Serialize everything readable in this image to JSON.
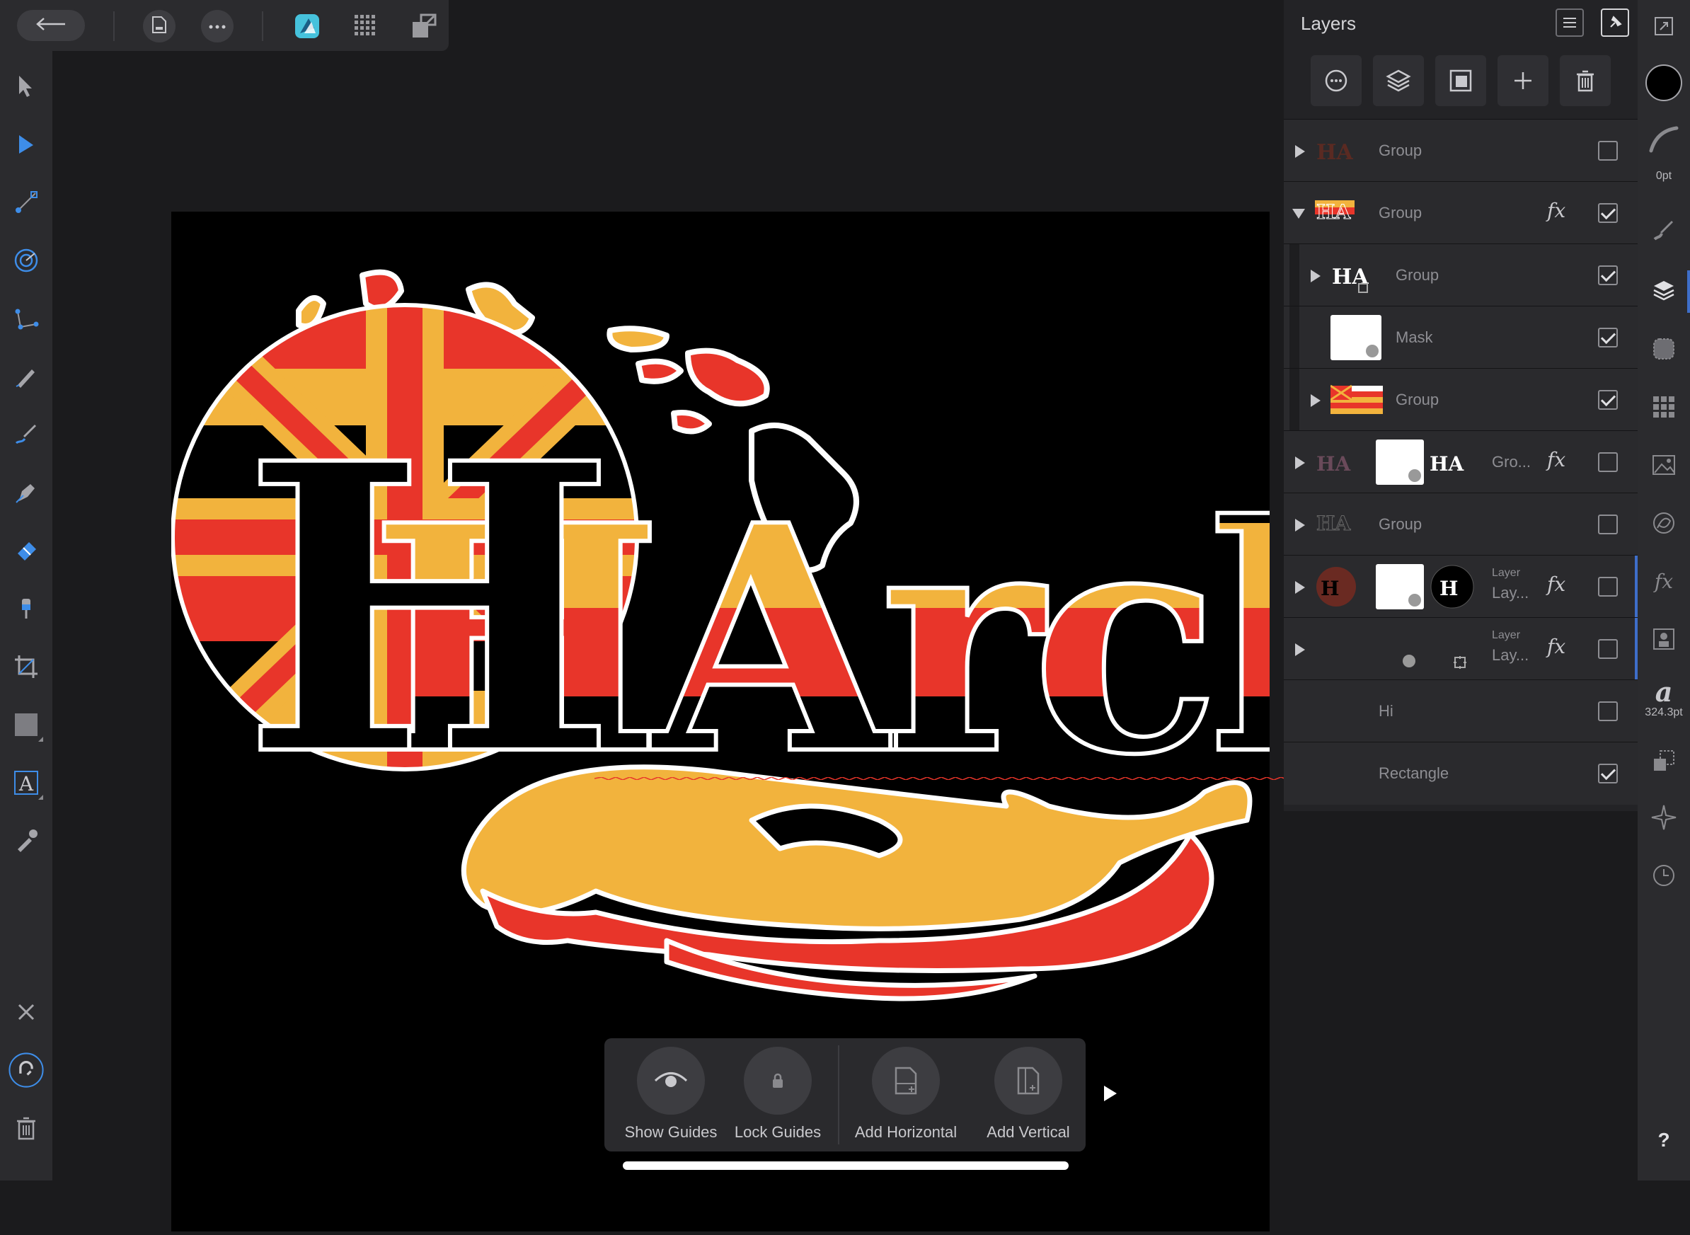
{
  "top_toolbar": {
    "icons": [
      "back-arrow-icon",
      "document-icon",
      "more-icon",
      "designer-persona-icon",
      "pixel-persona-icon",
      "export-persona-icon"
    ]
  },
  "left_tools": [
    "move-tool",
    "node-tool",
    "corner-tool",
    "contour-tool",
    "point-transform-tool",
    "pencil-tool",
    "vector-brush-tool",
    "pen-tool",
    "fill-tool",
    "transparency-tool",
    "crop-tool",
    "shape-tool",
    "artistic-text-tool",
    "color-picker-tool"
  ],
  "bottom_context": {
    "buttons": [
      {
        "label": "Show Guides",
        "icon": "eye-icon"
      },
      {
        "label": "Lock Guides",
        "icon": "lock-icon"
      },
      {
        "label": "Add Horizontal",
        "icon": "add-horizontal-guide-icon"
      },
      {
        "label": "Add Vertical",
        "icon": "add-vertical-guide-icon"
      }
    ]
  },
  "artwork": {
    "title_text": "HArchy",
    "stripe_colors": [
      "#e8352a",
      "#f2b33d",
      "#000000"
    ],
    "outline_color": "#ffffff"
  },
  "layers_panel": {
    "title": "Layers",
    "rows": [
      {
        "name": "Group",
        "expanded": false,
        "checked": false,
        "fx": false
      },
      {
        "name": "Group",
        "expanded": true,
        "checked": true,
        "fx": true
      },
      {
        "name": "Group",
        "expanded": false,
        "checked": true,
        "fx": false,
        "indent": true
      },
      {
        "name": "Mask",
        "checked": true,
        "fx": false,
        "indent": true
      },
      {
        "name": "Group",
        "expanded": false,
        "checked": true,
        "fx": false,
        "indent": true
      },
      {
        "name": "Gro...",
        "expanded": false,
        "checked": false,
        "fx": true
      },
      {
        "name": "Group",
        "expanded": false,
        "checked": false,
        "fx": false
      },
      {
        "name": "Lay...",
        "type": "Layer",
        "expanded": false,
        "checked": false,
        "fx": true
      },
      {
        "name": "Lay...",
        "type": "Layer",
        "expanded": false,
        "checked": false,
        "fx": true
      },
      {
        "name": "Hi",
        "checked": false,
        "fx": false
      },
      {
        "name": "Rectangle",
        "checked": true,
        "fx": false
      }
    ]
  },
  "right_studio": {
    "stroke_width": "0pt",
    "font_size": "324.3pt",
    "help": "?"
  }
}
